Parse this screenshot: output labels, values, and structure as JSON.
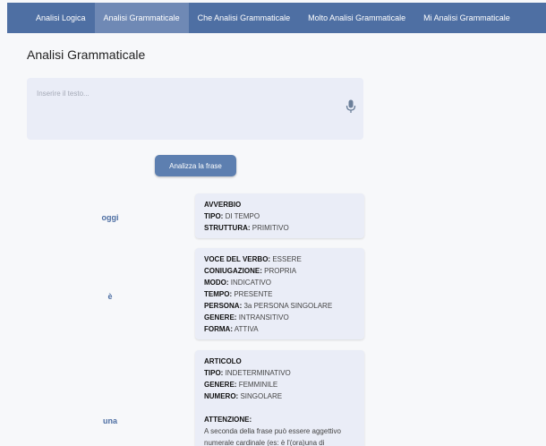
{
  "nav": {
    "items": [
      {
        "label": "Analisi Logica"
      },
      {
        "label": "Analisi Grammaticale"
      },
      {
        "label": "Che Analisi Grammaticale"
      },
      {
        "label": "Molto Analisi Grammaticale"
      },
      {
        "label": "Mi Analisi Grammaticale"
      }
    ],
    "active_index": 1
  },
  "page": {
    "title": "Analisi Grammaticale"
  },
  "input": {
    "placeholder": "Inserire il testo...",
    "value": ""
  },
  "analyze_button": {
    "label": "Analizza la frase"
  },
  "words": [
    {
      "word": "oggi",
      "heading": "AVVERBIO",
      "fields": [
        {
          "key": "TIPO:",
          "value": "DI TEMPO"
        },
        {
          "key": "STRUTTURA:",
          "value": "PRIMITIVO"
        }
      ]
    },
    {
      "word": "è",
      "heading": "",
      "fields": [
        {
          "key": "VOCE DEL VERBO:",
          "value": "ESSERE"
        },
        {
          "key": "CONIUGAZIONE:",
          "value": "PROPRIA"
        },
        {
          "key": "MODO:",
          "value": "INDICATIVO"
        },
        {
          "key": "TEMPO:",
          "value": "PRESENTE"
        },
        {
          "key": "PERSONA:",
          "value": "3a PERSONA SINGOLARE"
        },
        {
          "key": "GENERE:",
          "value": "INTRANSITIVO"
        },
        {
          "key": "FORMA:",
          "value": "ATTIVA"
        }
      ]
    },
    {
      "word": "una",
      "heading": "ARTICOLO",
      "fields": [
        {
          "key": "TIPO:",
          "value": "INDETERMINATIVO"
        },
        {
          "key": "GENERE:",
          "value": "FEMMINILE"
        },
        {
          "key": "NUMERO:",
          "value": "SINGOLARE"
        }
      ],
      "attention_heading": "ATTENZIONE:",
      "attention_text": "A seconda della frase può essere aggettivo numerale cardinale (es: è l'(ora)una di"
    }
  ],
  "colors": {
    "nav_bg": "#4e6fa3",
    "nav_active": "#6f89b5",
    "accent": "#4e6fa3",
    "card_bg": "#eaedf7"
  }
}
